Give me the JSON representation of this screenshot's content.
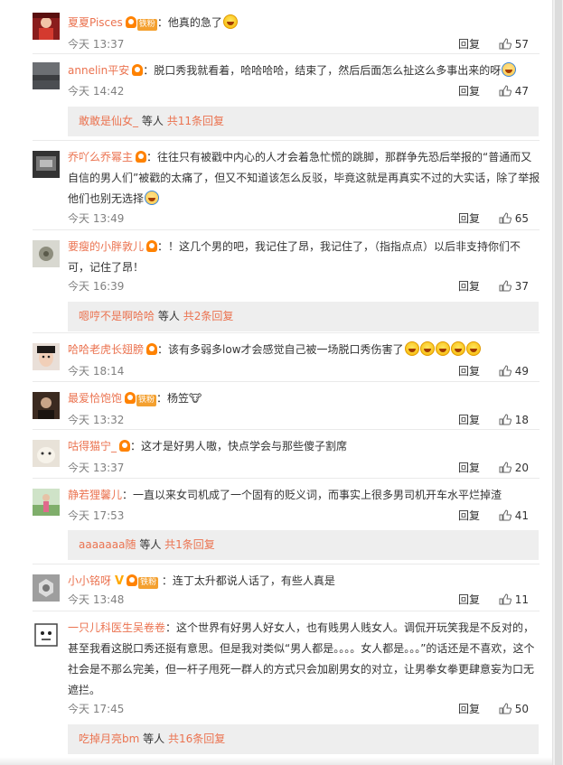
{
  "actions": {
    "reply": "回复",
    "with_others": "等人"
  },
  "comments": [
    {
      "user": "夏夏Pisces",
      "text": "：他真的急了",
      "time": "今天 13:37",
      "likes": "57"
    },
    {
      "user": "annelin平安",
      "text": "：脱口秀我就看着，哈哈哈哈，结束了，然后后面怎么扯这么多事出来的呀",
      "time": "今天 14:42",
      "likes": "47",
      "replies": {
        "name": "敢敢是仙女_",
        "count": "共11条回复"
      }
    },
    {
      "user": "乔吖么乔幂主",
      "text": "：往往只有被戳中内心的人才会着急忙慌的跳脚，那群争先恐后举报的“普通而又自信的男人们”被戳的太痛了，但又不知道该怎么反驳，毕竟这就是再真实不过的大实话，除了举报他们也别无选择",
      "time": "今天 13:49",
      "likes": "65"
    },
    {
      "user": "要瘦的小胖敦儿",
      "text": "：！这几个男的吧，我记住了昂，我记住了，（指指点点）以后非支持你们不可，记住了昂！",
      "time": "今天 16:39",
      "likes": "37",
      "replies": {
        "name": "嗯哼不是啊哈哈",
        "count": "共2条回复"
      }
    },
    {
      "user": "哈哈老虎长翅膀",
      "text": "：该有多弱多low才会感觉自己被一场脱口秀伤害了",
      "time": "今天 18:14",
      "likes": "49"
    },
    {
      "user": "最爱恰饱饱",
      "text": "：杨笠",
      "time": "今天 13:32",
      "likes": "18"
    },
    {
      "user": "咕得猫宁_",
      "text": "：这才是好男人嗷，快点学会与那些傻子割席",
      "time": "今天 13:37",
      "likes": "20"
    },
    {
      "user": "静若狸馨儿",
      "text": "：一直以来女司机成了一个固有的贬义词，而事实上很多男司机开车水平烂掉渣",
      "time": "今天 17:53",
      "likes": "41",
      "replies": {
        "name": "aaaaaaa随",
        "count": "共1条回复"
      }
    },
    {
      "user": "小小铭呀",
      "text": "：连丁太升都说人话了，有些人真是",
      "time": "今天 13:48",
      "likes": "11"
    },
    {
      "user": "一只儿科医生吴卷卷",
      "text": "：这个世界有好男人好女人，也有贱男人贱女人。调侃开玩笑我是不反对的，甚至我看这脱口秀还挺有意思。但是我对类似“男人都是。。。。女人都是。。。”的话还是不喜欢，这个社会是不那么完美，但一杆子甩死一群人的方式只会加剧男女的对立，让男拳女拳更肆意妄为口无遮拦。",
      "time": "今天 17:45",
      "likes": "50",
      "replies": {
        "name": "吃掉月亮bm",
        "count": "共16条回复"
      }
    }
  ],
  "badges": {
    "fan": "铁粉",
    "tyrant_icon": "🐮"
  },
  "colors": {
    "username": "#eb7350",
    "reply_box": "#eeeeee",
    "page": "#ffffff"
  },
  "icons": {
    "like": "thumbs-up-icon",
    "vip": "crown-icon",
    "verified": "v-icon",
    "emoji": "grin-emoji-icon"
  }
}
